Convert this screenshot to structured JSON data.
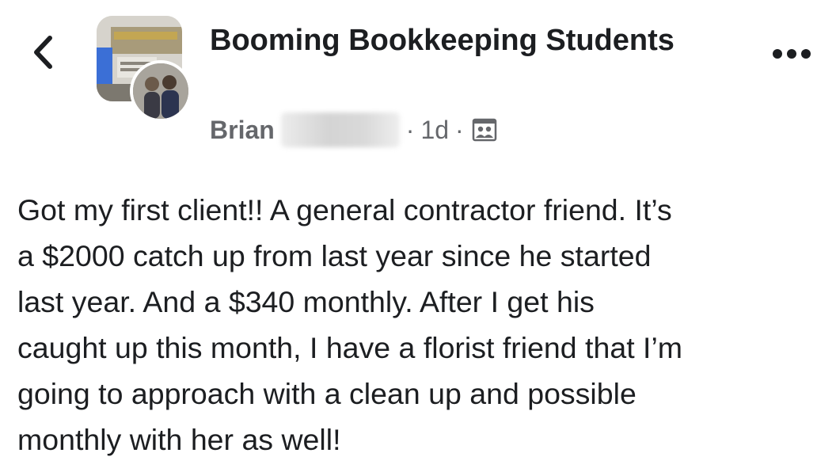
{
  "header": {
    "back_icon": "chevron-left-icon",
    "group_name": "Booming Bookkeeping Students",
    "more_icon": "ellipsis-icon"
  },
  "post": {
    "author_first_name": "Brian",
    "separator": "·",
    "time_ago": "1d",
    "privacy_icon": "group-members-icon",
    "body": "Got my first client!! A general contractor friend. It’s\na $2000 catch up from last year since he started\nlast year. And a $340 monthly. After I get his\ncaught up this month, I have a florist friend that I’m\ngoing to approach with a clean up and possible\nmonthly with her as well!"
  }
}
